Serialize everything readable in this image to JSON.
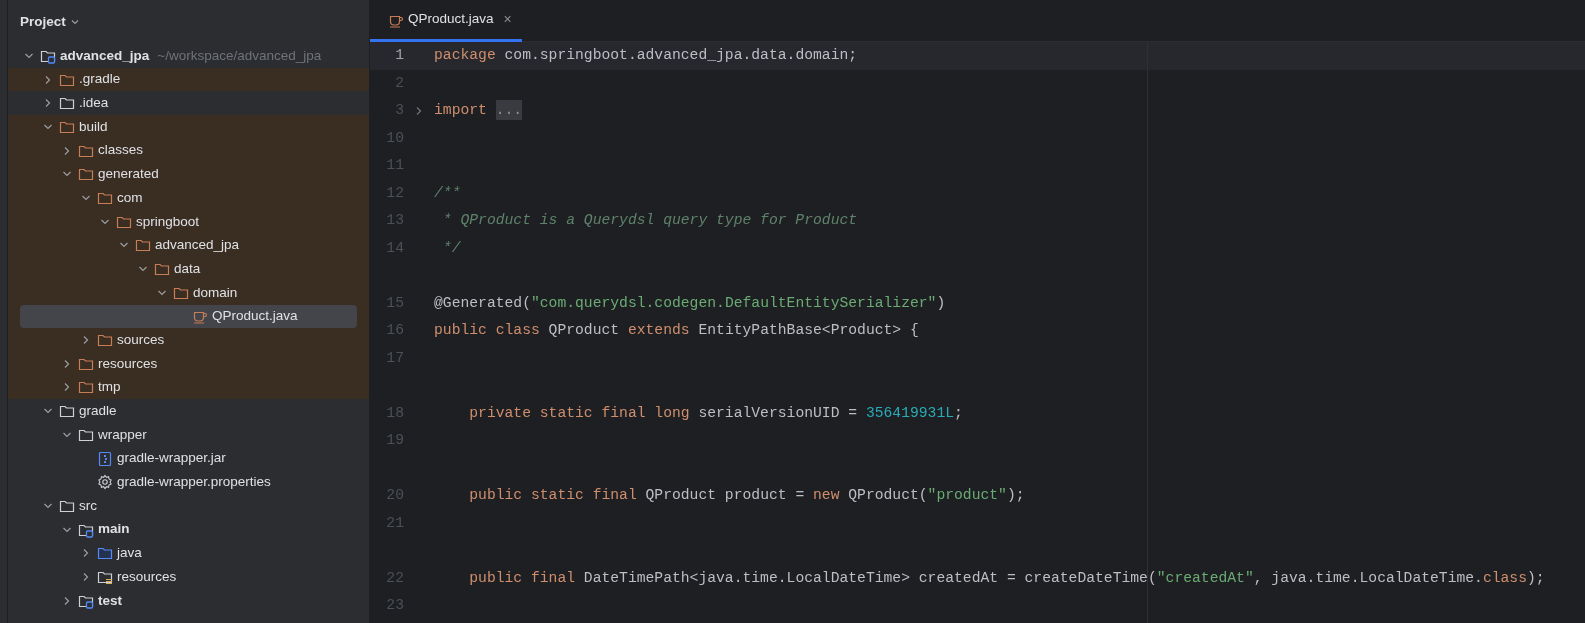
{
  "project_panel": {
    "title": "Project",
    "tree": [
      {
        "name": "advanced_jpa",
        "hint": "~/workspace/advanced_jpa",
        "kind": "module",
        "excluded": false,
        "expanded": true,
        "selected": false,
        "children": [
          {
            "name": ".gradle",
            "kind": "folder",
            "excluded": true,
            "expanded": false,
            "selected": false
          },
          {
            "name": ".idea",
            "kind": "folder",
            "excluded": false,
            "expanded": false,
            "selected": false
          },
          {
            "name": "build",
            "kind": "folder",
            "excluded": true,
            "expanded": true,
            "selected": false,
            "children": [
              {
                "name": "classes",
                "kind": "folder",
                "excluded": true,
                "expanded": false,
                "selected": false
              },
              {
                "name": "generated",
                "kind": "folder",
                "excluded": true,
                "expanded": true,
                "selected": false,
                "children": [
                  {
                    "name": "com",
                    "kind": "folder",
                    "excluded": true,
                    "expanded": true,
                    "selected": false,
                    "children": [
                      {
                        "name": "springboot",
                        "kind": "folder",
                        "excluded": true,
                        "expanded": true,
                        "selected": false,
                        "children": [
                          {
                            "name": "advanced_jpa",
                            "kind": "folder",
                            "excluded": true,
                            "expanded": true,
                            "selected": false,
                            "children": [
                              {
                                "name": "data",
                                "kind": "folder",
                                "excluded": true,
                                "expanded": true,
                                "selected": false,
                                "children": [
                                  {
                                    "name": "domain",
                                    "kind": "folder",
                                    "excluded": true,
                                    "expanded": true,
                                    "selected": false,
                                    "children": [
                                      {
                                        "name": "QProduct.java",
                                        "kind": "java-file",
                                        "excluded": true,
                                        "selected": true
                                      }
                                    ]
                                  }
                                ]
                              }
                            ]
                          }
                        ]
                      }
                    ]
                  },
                  {
                    "name": "sources",
                    "kind": "folder",
                    "excluded": true,
                    "expanded": false,
                    "selected": false
                  }
                ]
              },
              {
                "name": "resources",
                "kind": "folder",
                "excluded": true,
                "expanded": false,
                "selected": false
              },
              {
                "name": "tmp",
                "kind": "folder",
                "excluded": true,
                "expanded": false,
                "selected": false
              }
            ]
          },
          {
            "name": "gradle",
            "kind": "folder",
            "excluded": false,
            "expanded": true,
            "selected": false,
            "children": [
              {
                "name": "wrapper",
                "kind": "folder",
                "excluded": false,
                "expanded": true,
                "selected": false,
                "children": [
                  {
                    "name": "gradle-wrapper.jar",
                    "kind": "jar-file",
                    "excluded": false,
                    "selected": false
                  },
                  {
                    "name": "gradle-wrapper.properties",
                    "kind": "settings-file",
                    "excluded": false,
                    "selected": false
                  }
                ]
              }
            ]
          },
          {
            "name": "src",
            "kind": "folder",
            "excluded": false,
            "expanded": true,
            "selected": false,
            "children": [
              {
                "name": "main",
                "kind": "module",
                "excluded": false,
                "expanded": true,
                "selected": false,
                "children": [
                  {
                    "name": "java",
                    "kind": "source-folder",
                    "excluded": false,
                    "expanded": false,
                    "selected": false
                  },
                  {
                    "name": "resources",
                    "kind": "resources-folder",
                    "excluded": false,
                    "expanded": false,
                    "selected": false
                  }
                ]
              },
              {
                "name": "test",
                "kind": "module",
                "excluded": false,
                "expanded": false,
                "selected": false
              }
            ]
          }
        ]
      }
    ]
  },
  "editor": {
    "tabs": [
      {
        "label": "QProduct.java",
        "selected": true,
        "close": "×"
      }
    ],
    "lines": [
      {
        "number": "1",
        "current": true,
        "tokens": [
          {
            "kind": "keyword",
            "text": "package"
          },
          {
            "kind": "plain",
            "text": " com.springboot.advanced_jpa.data.domain;"
          }
        ]
      },
      {
        "number": "2",
        "current": false
      },
      {
        "number": "3",
        "current": false,
        "foldable": true,
        "tokens": [
          {
            "kind": "keyword",
            "text": "import"
          },
          {
            "kind": "fold",
            "text": "..."
          }
        ]
      },
      {
        "number": "10",
        "current": false
      },
      {
        "number": "11",
        "current": false
      },
      {
        "number": "12",
        "current": false,
        "tokens": [
          {
            "kind": "doc",
            "text": "/**"
          }
        ]
      },
      {
        "number": "13",
        "current": false,
        "tokens": [
          {
            "kind": "doc",
            "text": " * QProduct is a Querydsl query type for Product"
          }
        ]
      },
      {
        "number": "14",
        "current": false,
        "tokens": [
          {
            "kind": "doc",
            "text": " */"
          }
        ]
      },
      {
        "number": "15",
        "current": false,
        "spaced": true,
        "tokens": [
          {
            "kind": "plain",
            "text": "@Generated("
          },
          {
            "kind": "string",
            "text": "\"com.querydsl.codegen.DefaultEntitySerializer\""
          },
          {
            "kind": "plain",
            "text": ")"
          }
        ]
      },
      {
        "number": "16",
        "current": false,
        "tokens": [
          {
            "kind": "keyword",
            "text": "public class"
          },
          {
            "kind": "plain",
            "text": " QProduct "
          },
          {
            "kind": "keyword",
            "text": "extends"
          },
          {
            "kind": "plain",
            "text": " EntityPathBase<Product> {"
          }
        ]
      },
      {
        "number": "17",
        "current": false
      },
      {
        "number": "18",
        "current": false,
        "spaced": true,
        "tokens": [
          {
            "kind": "keyword",
            "text": "    private static final long"
          },
          {
            "kind": "plain",
            "text": " serialVersionUID = "
          },
          {
            "kind": "number",
            "text": "356419931L"
          },
          {
            "kind": "plain",
            "text": ";"
          }
        ]
      },
      {
        "number": "19",
        "current": false
      },
      {
        "number": "20",
        "current": false,
        "spaced": true,
        "tokens": [
          {
            "kind": "keyword",
            "text": "    public static final"
          },
          {
            "kind": "plain",
            "text": " QProduct product = "
          },
          {
            "kind": "keyword",
            "text": "new"
          },
          {
            "kind": "plain",
            "text": " QProduct("
          },
          {
            "kind": "string",
            "text": "\"product\""
          },
          {
            "kind": "plain",
            "text": ");"
          }
        ]
      },
      {
        "number": "21",
        "current": false
      },
      {
        "number": "22",
        "current": false,
        "spaced": true,
        "tokens": [
          {
            "kind": "keyword",
            "text": "    public final"
          },
          {
            "kind": "plain",
            "text": " DateTimePath<java.time.LocalDateTime> createdAt = createDateTime("
          },
          {
            "kind": "string",
            "text": "\"createdAt\""
          },
          {
            "kind": "plain",
            "text": ", java.time.LocalDateTime."
          },
          {
            "kind": "keyword",
            "text": "class"
          },
          {
            "kind": "plain",
            "text": ");"
          }
        ]
      },
      {
        "number": "23",
        "current": false
      }
    ]
  }
}
